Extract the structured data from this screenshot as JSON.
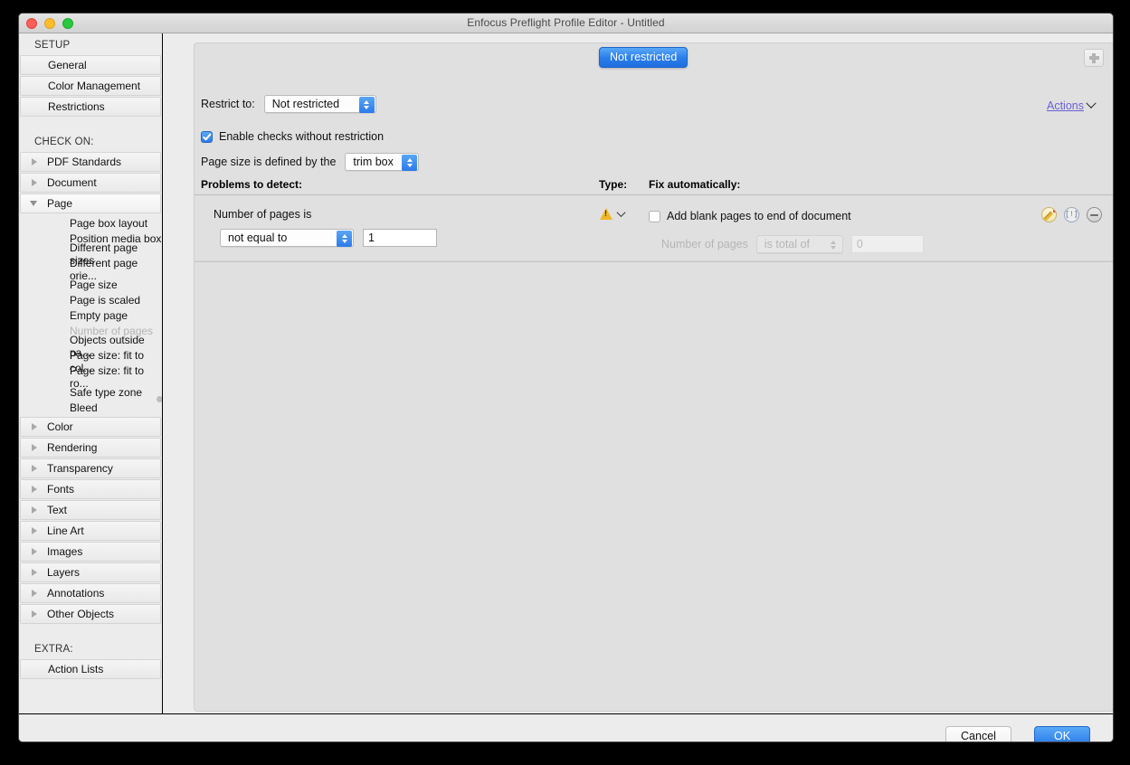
{
  "window": {
    "title": "Enfocus Preflight Profile Editor - Untitled",
    "traffic_lights": [
      "close-button",
      "minimize-button",
      "zoom-button"
    ]
  },
  "tooltip": {
    "text": "Not restricted"
  },
  "sidebar": {
    "setup_label": "SETUP",
    "setup_items": [
      {
        "label": "General"
      },
      {
        "label": "Color Management"
      },
      {
        "label": "Restrictions"
      }
    ],
    "check_on_label": "CHECK ON:",
    "groups": [
      {
        "label": "PDF Standards",
        "expanded": false
      },
      {
        "label": "Document",
        "expanded": false
      },
      {
        "label": "Page",
        "expanded": true
      }
    ],
    "page_subitems": [
      {
        "label": "Page box layout",
        "disabled": false
      },
      {
        "label": "Position media box",
        "disabled": false
      },
      {
        "label": "Different page sizes",
        "disabled": false
      },
      {
        "label": "Different page orie...",
        "disabled": false
      },
      {
        "label": "Page size",
        "disabled": false
      },
      {
        "label": "Page is scaled",
        "disabled": false
      },
      {
        "label": "Empty page",
        "disabled": false
      },
      {
        "label": "Number of pages",
        "disabled": true
      },
      {
        "label": "Objects outside pa...",
        "disabled": false
      },
      {
        "label": "Page size: fit to col...",
        "disabled": false
      },
      {
        "label": "Page size: fit to ro...",
        "disabled": false
      },
      {
        "label": "Safe type zone",
        "disabled": false
      },
      {
        "label": "Bleed",
        "disabled": false
      }
    ],
    "more_groups": [
      {
        "label": "Color"
      },
      {
        "label": "Rendering"
      },
      {
        "label": "Transparency"
      },
      {
        "label": "Fonts"
      },
      {
        "label": "Text"
      },
      {
        "label": "Line Art"
      },
      {
        "label": "Images"
      },
      {
        "label": "Layers"
      },
      {
        "label": "Annotations"
      },
      {
        "label": "Other Objects"
      }
    ],
    "extra_label": "EXTRA:",
    "extra_items": [
      {
        "label": "Action Lists"
      }
    ]
  },
  "panel": {
    "reset_icon": "reset-plus-icon",
    "restrict_label": "Restrict to:",
    "restrict_value": "Not restricted",
    "enable_checks_label": "Enable checks without restriction",
    "enable_checks_checked": true,
    "page_size_label": "Page size is defined by the",
    "page_size_value": "trim box",
    "actions_label": "Actions"
  },
  "table": {
    "header_problems": "Problems to detect:",
    "header_type": "Type:",
    "header_fix": "Fix automatically:",
    "row": {
      "detect_title": "Number of pages is",
      "operator_value": "not equal to",
      "operand_value": "1",
      "type_icon": "warning-triangle-icon",
      "fix_label": "Add blank pages to end of document",
      "fix_checked": false,
      "fix_sub_label": "Number of pages",
      "fix_sub_select": "is total of",
      "fix_sub_value": "0",
      "icons": {
        "edit": "pencil-icon",
        "info": "info-bracket-icon",
        "remove": "minus-circle-icon"
      }
    }
  },
  "footer": {
    "cancel_label": "Cancel",
    "ok_label": "OK"
  },
  "colors": {
    "accent_blue": "#2a7ce9",
    "link_purple": "#6b5fd6",
    "warning_yellow": "#f0b828"
  }
}
